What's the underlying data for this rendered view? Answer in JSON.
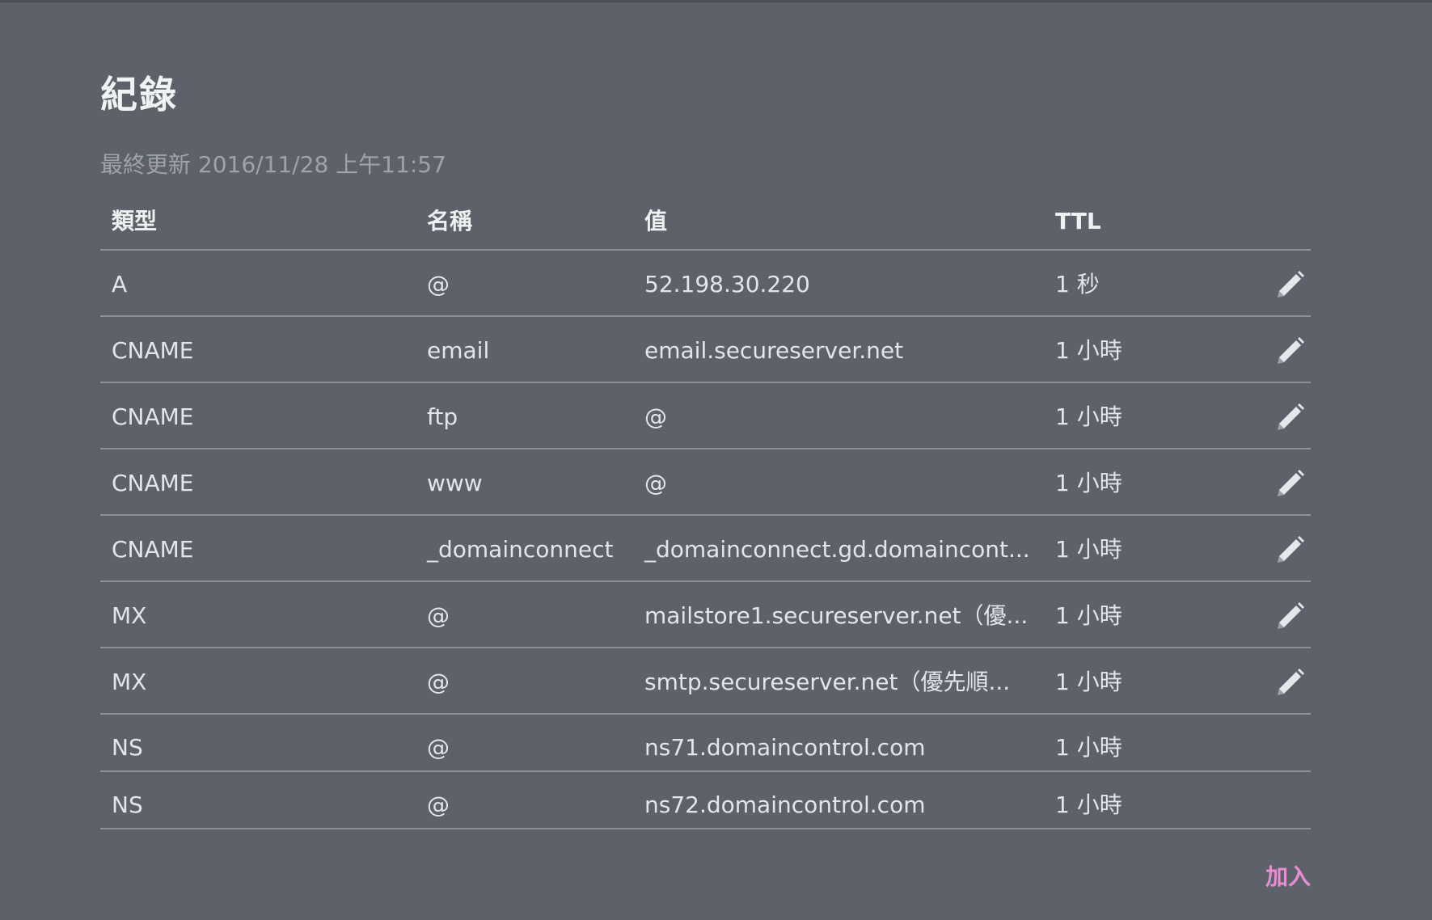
{
  "page": {
    "title": "紀錄",
    "last_updated": "最終更新 2016/11/28 上午11:57",
    "add_label": "加入"
  },
  "colors": {
    "background": "#5d626a",
    "accent": "#e58fcf",
    "text": "#e3e5e8",
    "muted": "#9ea3aa"
  },
  "table": {
    "headers": {
      "type": "類型",
      "name": "名稱",
      "value": "值",
      "ttl": "TTL"
    },
    "rows": [
      {
        "type": "A",
        "name": "@",
        "value": "52.198.30.220",
        "ttl": "1 秒",
        "editable": true,
        "edit_icon": "pencil-icon"
      },
      {
        "type": "CNAME",
        "name": "email",
        "value": "email.secureserver.net",
        "ttl": "1 小時",
        "editable": true,
        "edit_icon": "pencil-icon"
      },
      {
        "type": "CNAME",
        "name": "ftp",
        "value": "@",
        "ttl": "1 小時",
        "editable": true,
        "edit_icon": "pencil-icon"
      },
      {
        "type": "CNAME",
        "name": "www",
        "value": "@",
        "ttl": "1 小時",
        "editable": true,
        "edit_icon": "pencil-icon"
      },
      {
        "type": "CNAME",
        "name": "_domainconnect",
        "value": "_domainconnect.gd.domaincont...",
        "ttl": "1 小時",
        "editable": true,
        "edit_icon": "pencil-icon"
      },
      {
        "type": "MX",
        "name": "@",
        "value": "mailstore1.secureserver.net（優...",
        "ttl": "1 小時",
        "editable": true,
        "edit_icon": "pencil-icon"
      },
      {
        "type": "MX",
        "name": "@",
        "value": "smtp.secureserver.net（優先順...",
        "ttl": "1 小時",
        "editable": true,
        "edit_icon": "pencil-icon"
      },
      {
        "type": "NS",
        "name": "@",
        "value": "ns71.domaincontrol.com",
        "ttl": "1 小時",
        "editable": false
      },
      {
        "type": "NS",
        "name": "@",
        "value": "ns72.domaincontrol.com",
        "ttl": "1 小時",
        "editable": false
      }
    ]
  }
}
